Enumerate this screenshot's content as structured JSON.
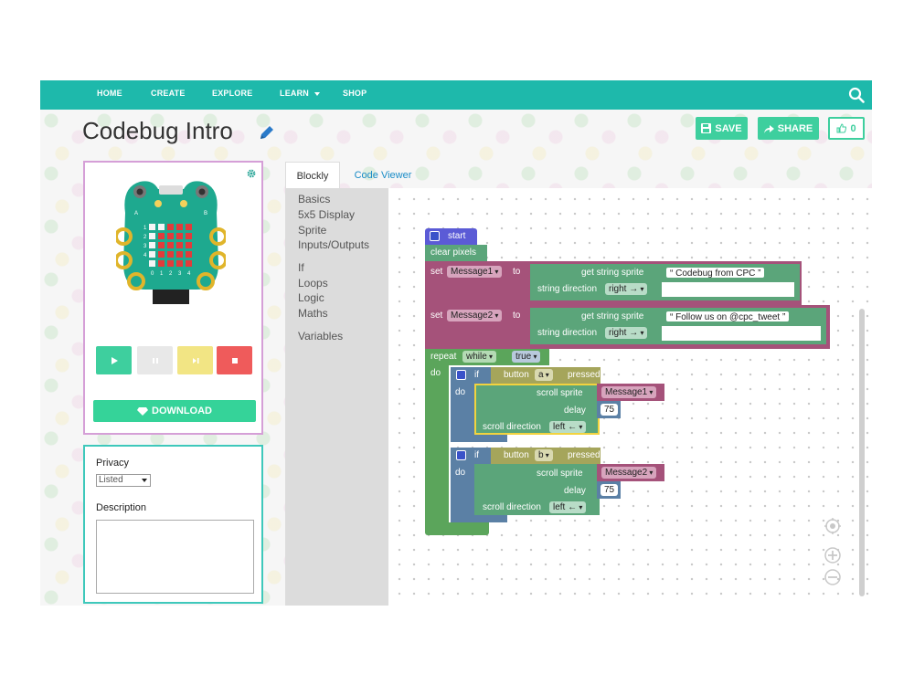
{
  "nav": {
    "items": [
      "HOME",
      "CREATE",
      "EXPLORE",
      "LEARN",
      "SHOP"
    ]
  },
  "header": {
    "title": "Codebug Intro",
    "save_label": "SAVE",
    "share_label": "SHARE",
    "like_count": "0"
  },
  "device": {
    "download_label": "DOWNLOAD",
    "pin_labels": [
      "A",
      "B"
    ],
    "row_labels": [
      "1",
      "2",
      "3",
      "4",
      "0",
      "1",
      "2",
      "3",
      "4"
    ]
  },
  "project": {
    "privacy_label": "Privacy",
    "privacy_value": "Listed",
    "description_label": "Description"
  },
  "editor": {
    "tabs": [
      "Blockly",
      "Code Viewer"
    ],
    "toolbox": [
      "Basics",
      "5x5 Display",
      "Sprite",
      "Inputs/Outputs",
      "If",
      "Loops",
      "Logic",
      "Maths",
      "Variables"
    ]
  },
  "blocks": {
    "start": "start",
    "clear": "clear pixels",
    "set1": {
      "set": "set",
      "var": "Message1",
      "to": "to",
      "get": "get string sprite",
      "string": "Codebug from CPC",
      "dir_label": "string direction",
      "dir": "right →"
    },
    "set2": {
      "set": "set",
      "var": "Message2",
      "to": "to",
      "get": "get string sprite",
      "string": "Follow us on @cpc_tweet",
      "dir_label": "string direction",
      "dir": "right →"
    },
    "repeat": {
      "repeat": "repeat",
      "mode": "while",
      "cond": "true",
      "do": "do"
    },
    "if1": {
      "if": "if",
      "do": "do",
      "button": "button",
      "btn": "a",
      "pressed": "pressed",
      "scroll": "scroll sprite",
      "var": "Message1",
      "delay": "delay",
      "delay_val": "75",
      "sdir": "scroll direction",
      "sdir_val": "left ←"
    },
    "if2": {
      "if": "if",
      "do": "do",
      "button": "button",
      "btn": "b",
      "pressed": "pressed",
      "scroll": "scroll sprite",
      "var": "Message2",
      "delay": "delay",
      "delay_val": "75",
      "sdir": "scroll direction",
      "sdir_val": "left ←"
    }
  },
  "colors": {
    "nav": "#1eb9ab",
    "accent": "#3ecf9e",
    "event": "#5b5bd6",
    "variable": "#a5527a",
    "loop": "#5ba55b",
    "logic": "#5b80a5",
    "text": "#5ba57a",
    "button": "#a5a55b"
  }
}
